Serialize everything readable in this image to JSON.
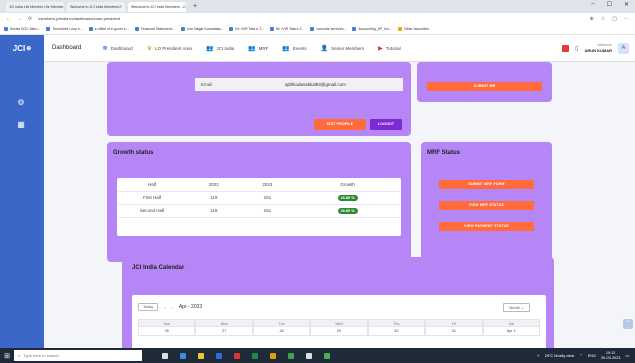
{
  "browser": {
    "tabs": [
      {
        "title": "JCI India Life Member Life Member"
      },
      {
        "title": "Welcome to JCI India Members"
      },
      {
        "title": "Welcome to JCI India Members - ZJ"
      }
    ],
    "new_tab": "+",
    "url": "members.jciindia.in/dashboard/zone-president",
    "window_controls": [
      "–",
      "☐",
      "✕"
    ],
    "bookmarks": [
      "Kerala SGC Mem...",
      "Tirunelveli Loop e...",
      "e-office of e-gover e...",
      "Financial Statement...",
      "Live Nagar Karnataka...",
      "IN: IVIR Tata e-T...",
      "IN: IVIR Tata e-T...",
      "consular services...",
      "Accounting_SP_Ins...",
      "Other favourites"
    ]
  },
  "app": {
    "brand": "JCI",
    "dashboard_label": "Dashboard",
    "nav": [
      {
        "label": "Dashboard",
        "icon": "team-icon"
      },
      {
        "label": "LO President Area",
        "icon": "trophy-icon"
      },
      {
        "label": "JCI India",
        "icon": "users-icon"
      },
      {
        "label": "MRF",
        "icon": "users-icon"
      },
      {
        "label": "Events",
        "icon": "users-icon"
      },
      {
        "label": "Senior Members",
        "icon": "user-icon"
      },
      {
        "label": "Tutorial",
        "icon": "youtube-icon"
      }
    ],
    "user": {
      "welcome": "Welcome",
      "name": "ARUN KUMAR",
      "initial": "A"
    }
  },
  "profile": {
    "email_label": "Email",
    "email_value": "ajithkodavakkal93@gmail.com",
    "edit_button": "EDIT PROFILE",
    "logout_button": "LOGOUT",
    "right_button": "SUBMIT MR"
  },
  "growth": {
    "title": "Growth status",
    "columns": [
      "Half",
      "2022",
      "2023",
      "Growth"
    ],
    "rows": [
      {
        "half": "First Half",
        "y2022": "119",
        "y2023": "151",
        "growth": "26.89 %"
      },
      {
        "half": "Second Half",
        "y2022": "119",
        "y2023": "151",
        "growth": "26.89 %"
      }
    ]
  },
  "mrf": {
    "title": "MRF Status",
    "buttons": [
      "SUBMIT MRF FORM",
      "VIEW MRF STATUS",
      "VIEW PAYMENT STATUS"
    ]
  },
  "calendar": {
    "title": "JCI India Calendar",
    "today_button": "Today",
    "prev": "‹",
    "next": "›",
    "month": "Apr - 2023",
    "view_select": "Month ⌄",
    "weekdays": [
      "Sun",
      "Mon",
      "Tue",
      "Wed",
      "Thu",
      "Fri",
      "Sat"
    ],
    "days": [
      "26",
      "27",
      "28",
      "29",
      "30",
      "31",
      "Apr 1"
    ]
  },
  "taskbar": {
    "search_placeholder": "Type here to search",
    "weather": "29°C Mostly clear",
    "time": "19:12",
    "date": "30-03-2023",
    "lang": "ENG"
  },
  "colors": {
    "brand_blue": "#3a67c8",
    "card_purple": "#b685f6",
    "action_orange": "#ff6b3d",
    "logout_purple": "#7b2bd0",
    "growth_green": "#2e8b35"
  }
}
